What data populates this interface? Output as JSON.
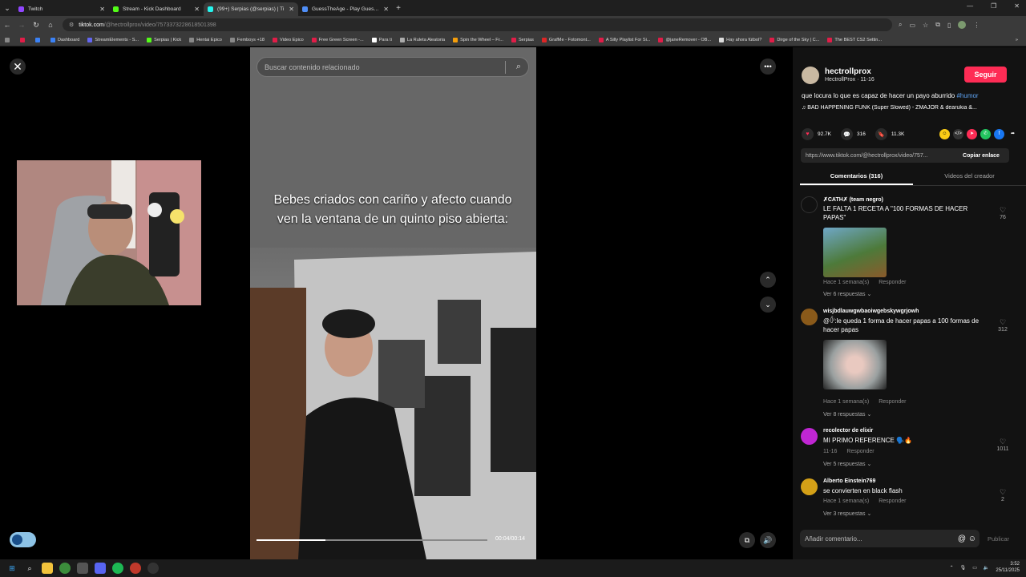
{
  "tabs": [
    {
      "title": "Twitch",
      "color": "#9146ff"
    },
    {
      "title": "Stream - Kick Dashboard",
      "color": "#53fc18"
    },
    {
      "title": "(99+) Serpias (@serpias) | Ti",
      "color": "#25f4ee",
      "active": true
    },
    {
      "title": "GuessTheAge - Play Guess The",
      "color": "#4f8ef7"
    }
  ],
  "address": {
    "host": "tiktok.com",
    "path": "/@hectrollprox/video/7573373228618501398"
  },
  "bookmarks": [
    {
      "label": "Dashboard",
      "color": "#3b82f6"
    },
    {
      "label": "StreamElements - S...",
      "color": "#6366f1"
    },
    {
      "label": "Serpias | Kick",
      "color": "#53fc18"
    },
    {
      "label": "Hentai Epico",
      "color": "#888"
    },
    {
      "label": "Femboys +18",
      "color": "#888"
    },
    {
      "label": "Video Epico",
      "color": "#e11d48"
    },
    {
      "label": "Free Green Screen -...",
      "color": "#e11d48"
    },
    {
      "label": "Para ti",
      "color": "#fff"
    },
    {
      "label": "La Ruleta Aleatoria",
      "color": "#aaa"
    },
    {
      "label": "Spin the Wheel – Fr...",
      "color": "#f59e0b"
    },
    {
      "label": "Serpias",
      "color": "#e11d48"
    },
    {
      "label": "GrafMe - Fotomont...",
      "color": "#dc2626"
    },
    {
      "label": "A Silly Playlist For Si...",
      "color": "#e11d48"
    },
    {
      "label": "@janeRemover - OB...",
      "color": "#e11d48"
    },
    {
      "label": "Hay ahora fútbol?",
      "color": "#ddd"
    },
    {
      "label": "Dirge of the Sky | C...",
      "color": "#e11d48"
    },
    {
      "label": "The BEST CS2 Settin...",
      "color": "#e11d48"
    }
  ],
  "video": {
    "search_placeholder": "Buscar contenido relacionado",
    "caption": "Bebes criados con cariño y afecto cuando ven la ventana de un quinto piso abierta:",
    "time": "00:04/00:14",
    "progress": 0.3
  },
  "panel": {
    "username": "hectrollprox",
    "sub": "HectrollProx · 11-16",
    "follow": "Seguir",
    "desc": "que locura lo que es capaz de hacer un payo aburrido ",
    "hashtag": "#humor",
    "music": "BAD HAPPENING FUNK (Super Slowed) - ZMAJOR & dearukia &...",
    "likes": "92.7K",
    "comments": "316",
    "saves": "11.3K",
    "link": "https://www.tiktok.com/@hectrollprox/video/757...",
    "copy": "Copiar enlace",
    "tab_comments": "Comentarios (316)",
    "tab_creator": "Videos del creador",
    "add_comment": "Añadir comentario...",
    "publish": "Publicar"
  },
  "comments": [
    {
      "name": "✗CATH✗ (team negro)",
      "text": "LE FALTA 1 RECETA A \"100 FORMAS DE HACER PAPAS\"",
      "meta": "Hace 1 semana(s)",
      "reply": "Responder",
      "more": "Ver 6 respuestas",
      "likes": "76"
    },
    {
      "name": "wisjbdlauwgwbaoiwgebskywgrjowh",
      "text": "@ꊳ:le queda 1 forma de hacer papas a 100 formas de hacer papas",
      "meta": "Hace 1 semana(s)",
      "reply": "Responder",
      "more": "Ver 8 respuestas",
      "likes": "312"
    },
    {
      "name": "recolector de elixir",
      "text": "MI PRIMO REFERENCE 🗣️🔥",
      "meta": "11-16",
      "reply": "Responder",
      "more": "Ver 5 respuestas",
      "likes": "1011"
    },
    {
      "name": "Alberto Einstein769",
      "text": "se convierten en black flash",
      "meta": "Hace 1 semana(s)",
      "reply": "Responder",
      "more": "Ver 3 respuestas",
      "likes": "2"
    }
  ],
  "clock": {
    "time": "3:52",
    "date": "25/11/2025"
  }
}
